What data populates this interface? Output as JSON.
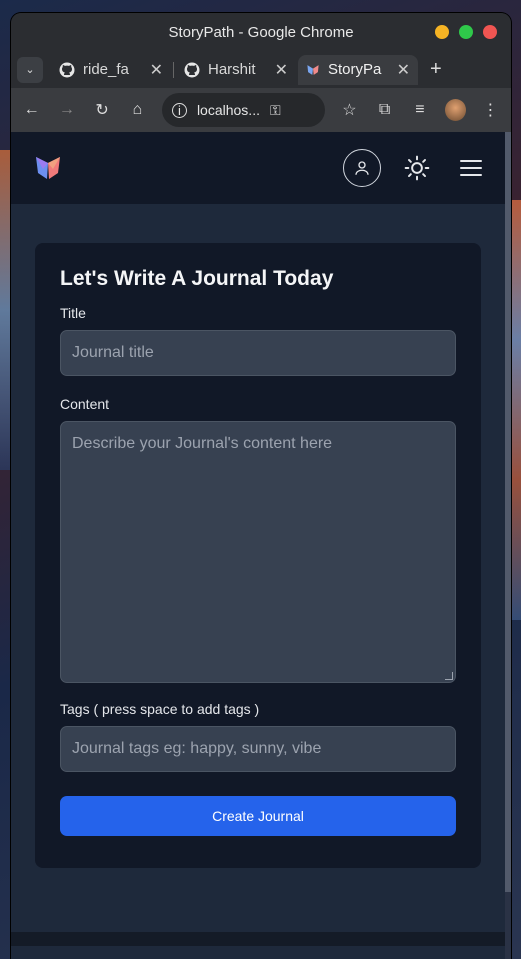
{
  "window": {
    "title": "StoryPath - Google Chrome"
  },
  "tabs": [
    {
      "label": "ride_fa",
      "icon": "github-icon",
      "active": false
    },
    {
      "label": "Harshit",
      "icon": "github-icon",
      "active": false
    },
    {
      "label": "StoryPa",
      "icon": "storypath-icon",
      "active": true
    }
  ],
  "toolbar": {
    "url": "localhos..."
  },
  "colors": {
    "accent": "#2563eb",
    "card": "#111827",
    "field": "#374151",
    "page": "#1e293b"
  },
  "form": {
    "heading": "Let's Write A Journal Today",
    "title_label": "Title",
    "title_placeholder": "Journal title",
    "content_label": "Content",
    "content_placeholder": "Describe your Journal's content here",
    "tags_label": "Tags ( press space to add tags )",
    "tags_placeholder": "Journal tags eg: happy, sunny, vibe",
    "submit_label": "Create Journal"
  }
}
